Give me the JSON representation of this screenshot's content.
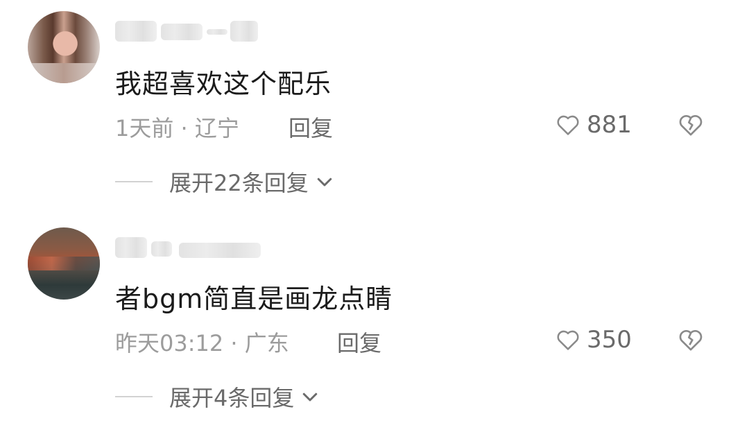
{
  "comments": [
    {
      "content": "我超喜欢这个配乐",
      "time_location": "1天前 · 辽宁",
      "reply_label": "回复",
      "like_count": "881",
      "expand_label": "展开22条回复",
      "icons": {
        "like": "heart-outline-icon",
        "dislike": "broken-heart-icon",
        "expand": "chevron-down-icon"
      }
    },
    {
      "content": "者bgm简直是画龙点睛",
      "time_location": "昨天03:12 · 广东",
      "reply_label": "回复",
      "like_count": "350",
      "expand_label": "展开4条回复",
      "icons": {
        "like": "heart-outline-icon",
        "dislike": "broken-heart-icon",
        "expand": "chevron-down-icon"
      }
    }
  ],
  "colors": {
    "text_primary": "#1b1b1b",
    "text_secondary": "#9c9c9c",
    "text_action": "#6a6a6a"
  }
}
